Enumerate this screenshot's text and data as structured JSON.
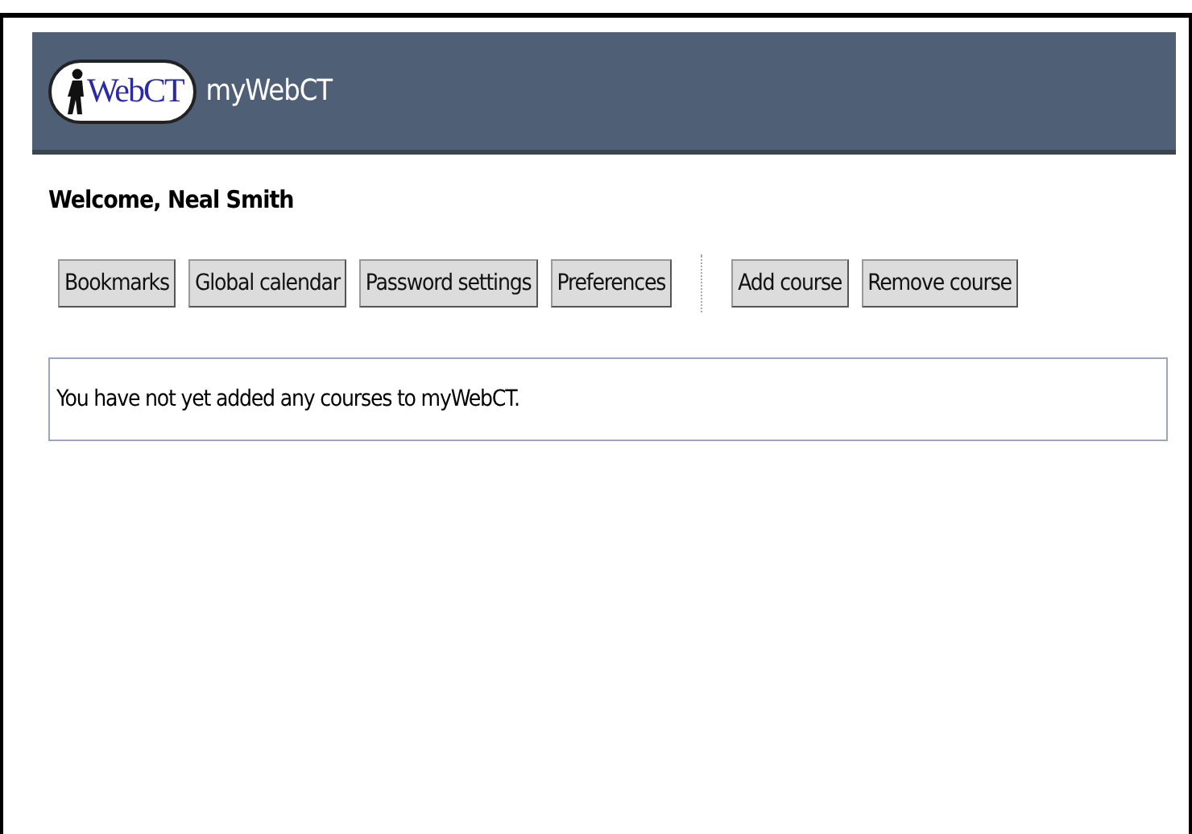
{
  "header": {
    "logo_text": "WebCT",
    "title": "myWebCT"
  },
  "welcome": "Welcome, Neal Smith",
  "button_groups": [
    [
      "Bookmarks",
      "Global calendar",
      "Password settings",
      "Preferences"
    ],
    [
      "Add course",
      "Remove course"
    ]
  ],
  "message": "You have not yet added any courses to myWebCT."
}
